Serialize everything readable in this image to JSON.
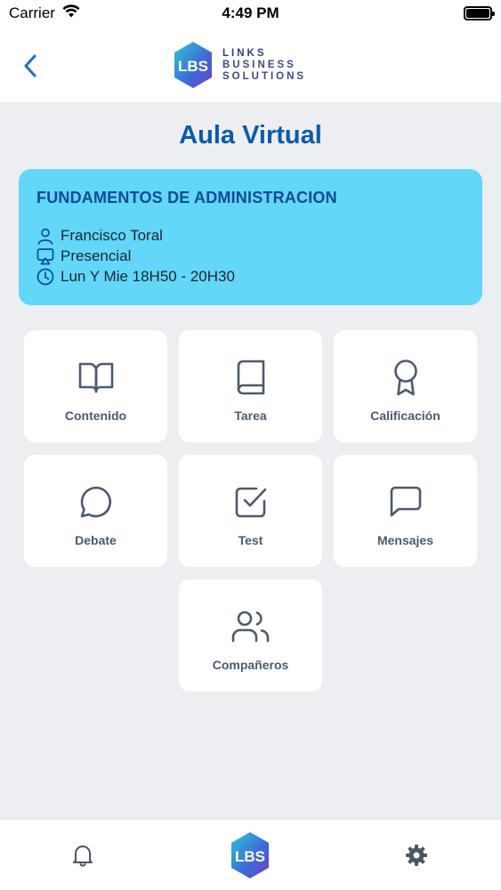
{
  "status_bar": {
    "carrier": "Carrier",
    "time": "4:49 PM"
  },
  "header": {
    "brand_line1": "LINKS",
    "brand_line2": "BUSINESS",
    "brand_line3": "SOLUTIONS"
  },
  "page": {
    "title": "Aula Virtual"
  },
  "course": {
    "name": "FUNDAMENTOS DE ADMINISTRACION",
    "teacher": "Francisco Toral",
    "modality": "Presencial",
    "schedule": "Lun Y Mie 18H50 - 20H30"
  },
  "menu": {
    "items": [
      {
        "label": "Contenido",
        "icon": "book-open-icon"
      },
      {
        "label": "Tarea",
        "icon": "book-icon"
      },
      {
        "label": "Calificación",
        "icon": "award-icon"
      },
      {
        "label": "Debate",
        "icon": "chat-bubble-icon"
      },
      {
        "label": "Test",
        "icon": "checkbox-icon"
      },
      {
        "label": "Mensajes",
        "icon": "message-square-icon"
      },
      {
        "label": "Compañeros",
        "icon": "users-icon"
      }
    ]
  },
  "tabbar": {
    "items": [
      "bell-icon",
      "home-logo-icon",
      "gear-icon"
    ]
  },
  "colors": {
    "accent": "#0d5aa7",
    "card_bg": "#62d7f7",
    "background": "#eceef2",
    "icon": "#4b5a6d"
  }
}
